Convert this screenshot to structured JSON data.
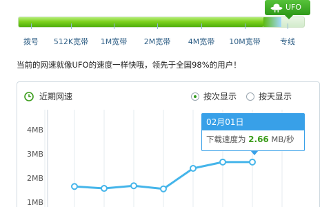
{
  "ufo_badge": {
    "label": "UFO"
  },
  "speed_meter": {
    "tiers": [
      "拨号",
      "512K宽带",
      "1M宽带",
      "2M宽带",
      "4M宽带",
      "10M宽带",
      "专线"
    ],
    "level_percent": 92
  },
  "summary": "当前的网速就像UFO的速度一样快哦，领先于全国98%的用户！",
  "panel": {
    "title": "近期网速",
    "view_options": [
      {
        "label": "按次显示",
        "selected": true
      },
      {
        "label": "按天显示",
        "selected": false
      }
    ]
  },
  "tooltip": {
    "date": "02月01日",
    "prefix": "下载速度为",
    "value": "2.66",
    "unit": "MB/秒"
  },
  "chart_data": {
    "type": "line",
    "title": "近期网速",
    "y_tick_labels": [
      "1MB",
      "2MB",
      "3MB",
      "4MB"
    ],
    "y_ticks": [
      1,
      2,
      3,
      4
    ],
    "ylim": [
      0.8,
      4.4
    ],
    "x_index": [
      1,
      2,
      3,
      4,
      5,
      6,
      7
    ],
    "series": [
      {
        "values": [
          1.65,
          1.57,
          1.68,
          1.55,
          2.4,
          2.66,
          2.66
        ],
        "color": "#45b5ea"
      }
    ],
    "highlighted_index": 6,
    "grid": "vertical"
  },
  "colors": {
    "accent_green": "#3a9c1a",
    "line_blue": "#45b5ea",
    "tooltip_blue": "#38a0e8"
  }
}
